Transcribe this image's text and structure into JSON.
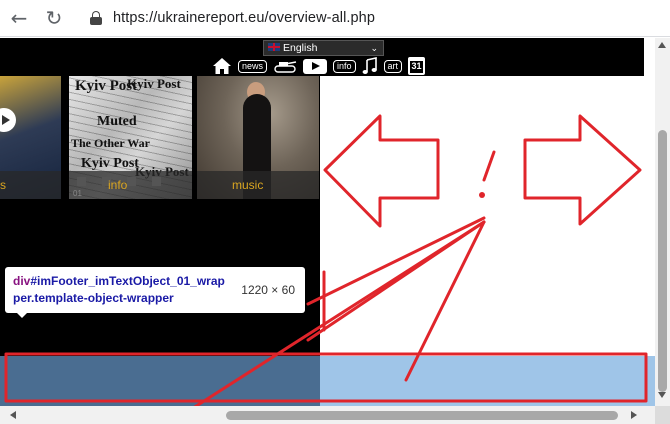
{
  "browser": {
    "url": "https://ukrainereport.eu/overview-all.php"
  },
  "site": {
    "language": "English",
    "nav": {
      "news": "news",
      "info": "info",
      "art": "art",
      "calendar_day": "31"
    },
    "thumbnails": [
      {
        "caption": "s"
      },
      {
        "caption": "info",
        "paper_titles": [
          "Kyiv Post",
          "Kyiv Post",
          "Muted",
          "The Other War",
          "Kyiv Post",
          "Kyiv Post"
        ],
        "index": "01"
      },
      {
        "caption": "music"
      }
    ]
  },
  "devtools_tooltip": {
    "tag": "div",
    "id_class": "#imFooter_imTextObject_01_wrapper.template-object-wrapper",
    "dimensions": "1220 × 60"
  },
  "colors": {
    "footer_dark": "#4a6d91",
    "footer_light": "#9fc5e8",
    "annotation_red": "#e0252b",
    "caption_gold": "#d9a520"
  }
}
